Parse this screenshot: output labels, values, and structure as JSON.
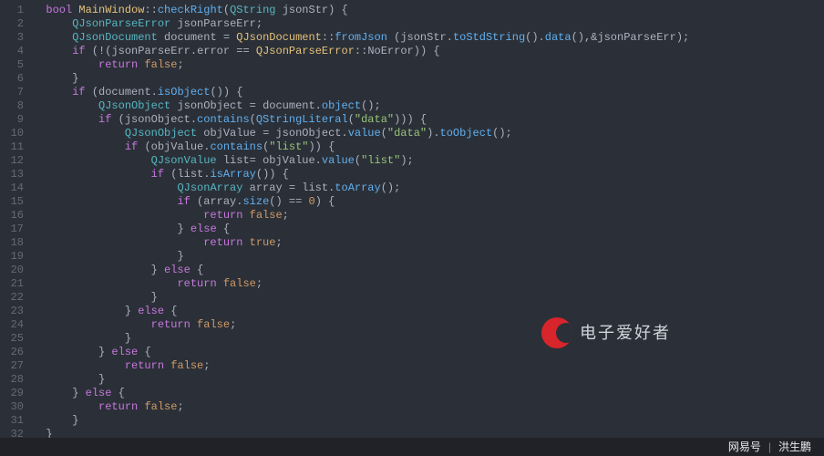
{
  "editor": {
    "language": "cpp",
    "lines": [
      {
        "n": 1,
        "tokens": [
          [
            "kw",
            "bool"
          ],
          [
            "",
            null
          ],
          [
            "cls",
            "MainWindow"
          ],
          [
            "op",
            "::"
          ],
          [
            "fn",
            "checkRight"
          ],
          [
            "punct",
            "("
          ],
          [
            "type",
            "QString"
          ],
          [
            "",
            null
          ],
          [
            "ident",
            "jsonStr"
          ],
          [
            "punct",
            ") {"
          ]
        ]
      },
      {
        "n": 2,
        "indent": 1,
        "tokens": [
          [
            "type",
            "QJsonParseError"
          ],
          [
            "",
            null
          ],
          [
            "ident",
            "jsonParseErr"
          ],
          [
            "punct",
            ";"
          ]
        ]
      },
      {
        "n": 3,
        "indent": 1,
        "tokens": [
          [
            "type",
            "QJsonDocument"
          ],
          [
            "",
            null
          ],
          [
            "ident",
            "document"
          ],
          [
            "",
            null
          ],
          [
            "op",
            "="
          ],
          [
            "",
            null
          ],
          [
            "cls",
            "QJsonDocument"
          ],
          [
            "op",
            "::"
          ],
          [
            "fn",
            "fromJson"
          ],
          [
            "",
            null
          ],
          [
            "punct",
            "("
          ],
          [
            "ident",
            "jsonStr"
          ],
          [
            "punct",
            "."
          ],
          [
            "fn",
            "toStdString"
          ],
          [
            "punct",
            "()."
          ],
          [
            "fn",
            "data"
          ],
          [
            "punct",
            "(),&"
          ],
          [
            "ident",
            "jsonParseErr"
          ],
          [
            "punct",
            ");"
          ]
        ]
      },
      {
        "n": 4,
        "indent": 1,
        "tokens": [
          [
            "kw",
            "if"
          ],
          [
            "",
            null
          ],
          [
            "punct",
            "(!("
          ],
          [
            "ident",
            "jsonParseErr"
          ],
          [
            "punct",
            "."
          ],
          [
            "ident",
            "error"
          ],
          [
            "",
            null
          ],
          [
            "op",
            "=="
          ],
          [
            "",
            null
          ],
          [
            "cls",
            "QJsonParseError"
          ],
          [
            "op",
            "::"
          ],
          [
            "ident",
            "NoError"
          ],
          [
            "punct",
            ")) {"
          ]
        ]
      },
      {
        "n": 5,
        "indent": 2,
        "tokens": [
          [
            "kw",
            "return"
          ],
          [
            "",
            null
          ],
          [
            "bool",
            "false"
          ],
          [
            "punct",
            ";"
          ]
        ]
      },
      {
        "n": 6,
        "indent": 1,
        "tokens": [
          [
            "punct",
            "}"
          ]
        ]
      },
      {
        "n": 7,
        "indent": 1,
        "tokens": [
          [
            "kw",
            "if"
          ],
          [
            "",
            null
          ],
          [
            "punct",
            "("
          ],
          [
            "ident",
            "document"
          ],
          [
            "punct",
            "."
          ],
          [
            "fn",
            "isObject"
          ],
          [
            "punct",
            "()) {"
          ]
        ]
      },
      {
        "n": 8,
        "indent": 2,
        "tokens": [
          [
            "type",
            "QJsonObject"
          ],
          [
            "",
            null
          ],
          [
            "ident",
            "jsonObject"
          ],
          [
            "",
            null
          ],
          [
            "op",
            "="
          ],
          [
            "",
            null
          ],
          [
            "ident",
            "document"
          ],
          [
            "punct",
            "."
          ],
          [
            "fn",
            "object"
          ],
          [
            "punct",
            "();"
          ]
        ]
      },
      {
        "n": 9,
        "indent": 2,
        "tokens": [
          [
            "kw",
            "if"
          ],
          [
            "",
            null
          ],
          [
            "punct",
            "("
          ],
          [
            "ident",
            "jsonObject"
          ],
          [
            "punct",
            "."
          ],
          [
            "fn",
            "contains"
          ],
          [
            "punct",
            "("
          ],
          [
            "fn",
            "QStringLiteral"
          ],
          [
            "punct",
            "("
          ],
          [
            "str",
            "\"data\""
          ],
          [
            "punct",
            "))) {"
          ]
        ]
      },
      {
        "n": 10,
        "indent": 3,
        "tokens": [
          [
            "type",
            "QJsonObject"
          ],
          [
            "",
            null
          ],
          [
            "ident",
            "objValue"
          ],
          [
            "",
            null
          ],
          [
            "op",
            "="
          ],
          [
            "",
            null
          ],
          [
            "ident",
            "jsonObject"
          ],
          [
            "punct",
            "."
          ],
          [
            "fn",
            "value"
          ],
          [
            "punct",
            "("
          ],
          [
            "str",
            "\"data\""
          ],
          [
            "punct",
            ")."
          ],
          [
            "fn",
            "toObject"
          ],
          [
            "punct",
            "();"
          ]
        ]
      },
      {
        "n": 11,
        "indent": 3,
        "tokens": [
          [
            "kw",
            "if"
          ],
          [
            "",
            null
          ],
          [
            "punct",
            "("
          ],
          [
            "ident",
            "objValue"
          ],
          [
            "punct",
            "."
          ],
          [
            "fn",
            "contains"
          ],
          [
            "punct",
            "("
          ],
          [
            "str",
            "\"list\""
          ],
          [
            "punct",
            ")) {"
          ]
        ]
      },
      {
        "n": 12,
        "indent": 4,
        "tokens": [
          [
            "type",
            "QJsonValue"
          ],
          [
            "",
            null
          ],
          [
            "ident",
            "list"
          ],
          [
            "op",
            "="
          ],
          [
            "",
            null
          ],
          [
            "ident",
            "objValue"
          ],
          [
            "punct",
            "."
          ],
          [
            "fn",
            "value"
          ],
          [
            "punct",
            "("
          ],
          [
            "str",
            "\"list\""
          ],
          [
            "punct",
            ");"
          ]
        ]
      },
      {
        "n": 13,
        "indent": 4,
        "tokens": [
          [
            "kw",
            "if"
          ],
          [
            "",
            null
          ],
          [
            "punct",
            "("
          ],
          [
            "ident",
            "list"
          ],
          [
            "punct",
            "."
          ],
          [
            "fn",
            "isArray"
          ],
          [
            "punct",
            "()) {"
          ]
        ]
      },
      {
        "n": 14,
        "indent": 5,
        "tokens": [
          [
            "type",
            "QJsonArray"
          ],
          [
            "",
            null
          ],
          [
            "ident",
            "array"
          ],
          [
            "",
            null
          ],
          [
            "op",
            "="
          ],
          [
            "",
            null
          ],
          [
            "ident",
            "list"
          ],
          [
            "punct",
            "."
          ],
          [
            "fn",
            "toArray"
          ],
          [
            "punct",
            "();"
          ]
        ]
      },
      {
        "n": 15,
        "indent": 5,
        "tokens": [
          [
            "kw",
            "if"
          ],
          [
            "",
            null
          ],
          [
            "punct",
            "("
          ],
          [
            "ident",
            "array"
          ],
          [
            "punct",
            "."
          ],
          [
            "fn",
            "size"
          ],
          [
            "punct",
            "()"
          ],
          [
            "",
            null
          ],
          [
            "op",
            "=="
          ],
          [
            "",
            null
          ],
          [
            "num",
            "0"
          ],
          [
            "punct",
            ") {"
          ]
        ]
      },
      {
        "n": 16,
        "indent": 6,
        "tokens": [
          [
            "kw",
            "return"
          ],
          [
            "",
            null
          ],
          [
            "bool",
            "false"
          ],
          [
            "punct",
            ";"
          ]
        ]
      },
      {
        "n": 17,
        "indent": 5,
        "tokens": [
          [
            "punct",
            "}"
          ],
          [
            "",
            null
          ],
          [
            "kw",
            "else"
          ],
          [
            "",
            null
          ],
          [
            "punct",
            "{"
          ]
        ]
      },
      {
        "n": 18,
        "indent": 6,
        "tokens": [
          [
            "kw",
            "return"
          ],
          [
            "",
            null
          ],
          [
            "bool",
            "true"
          ],
          [
            "punct",
            ";"
          ]
        ]
      },
      {
        "n": 19,
        "indent": 5,
        "tokens": [
          [
            "punct",
            "}"
          ]
        ]
      },
      {
        "n": 20,
        "indent": 4,
        "tokens": [
          [
            "punct",
            "}"
          ],
          [
            "",
            null
          ],
          [
            "kw",
            "else"
          ],
          [
            "",
            null
          ],
          [
            "punct",
            "{"
          ]
        ]
      },
      {
        "n": 21,
        "indent": 5,
        "tokens": [
          [
            "kw",
            "return"
          ],
          [
            "",
            null
          ],
          [
            "bool",
            "false"
          ],
          [
            "punct",
            ";"
          ]
        ]
      },
      {
        "n": 22,
        "indent": 4,
        "tokens": [
          [
            "punct",
            "}"
          ]
        ]
      },
      {
        "n": 23,
        "indent": 3,
        "tokens": [
          [
            "punct",
            "}"
          ],
          [
            "",
            null
          ],
          [
            "kw",
            "else"
          ],
          [
            "",
            null
          ],
          [
            "punct",
            "{"
          ]
        ]
      },
      {
        "n": 24,
        "indent": 4,
        "tokens": [
          [
            "kw",
            "return"
          ],
          [
            "",
            null
          ],
          [
            "bool",
            "false"
          ],
          [
            "punct",
            ";"
          ]
        ]
      },
      {
        "n": 25,
        "indent": 3,
        "tokens": [
          [
            "punct",
            "}"
          ]
        ]
      },
      {
        "n": 26,
        "indent": 2,
        "tokens": [
          [
            "punct",
            "}"
          ],
          [
            "",
            null
          ],
          [
            "kw",
            "else"
          ],
          [
            "",
            null
          ],
          [
            "punct",
            "{"
          ]
        ]
      },
      {
        "n": 27,
        "indent": 3,
        "tokens": [
          [
            "kw",
            "return"
          ],
          [
            "",
            null
          ],
          [
            "bool",
            "false"
          ],
          [
            "punct",
            ";"
          ]
        ]
      },
      {
        "n": 28,
        "indent": 2,
        "tokens": [
          [
            "punct",
            "}"
          ]
        ]
      },
      {
        "n": 29,
        "indent": 1,
        "tokens": [
          [
            "punct",
            "}"
          ],
          [
            "",
            null
          ],
          [
            "kw",
            "else"
          ],
          [
            "",
            null
          ],
          [
            "punct",
            "{"
          ]
        ]
      },
      {
        "n": 30,
        "indent": 2,
        "tokens": [
          [
            "kw",
            "return"
          ],
          [
            "",
            null
          ],
          [
            "bool",
            "false"
          ],
          [
            "punct",
            ";"
          ]
        ]
      },
      {
        "n": 31,
        "indent": 1,
        "tokens": [
          [
            "punct",
            "}"
          ]
        ]
      },
      {
        "n": 32,
        "indent": 0,
        "tokens": [
          [
            "punct",
            "}"
          ]
        ]
      }
    ]
  },
  "watermark": {
    "brand": "电子爱好者"
  },
  "footer": {
    "source_label": "网易号",
    "author": "洪生鹏"
  },
  "indent_unit": "    "
}
